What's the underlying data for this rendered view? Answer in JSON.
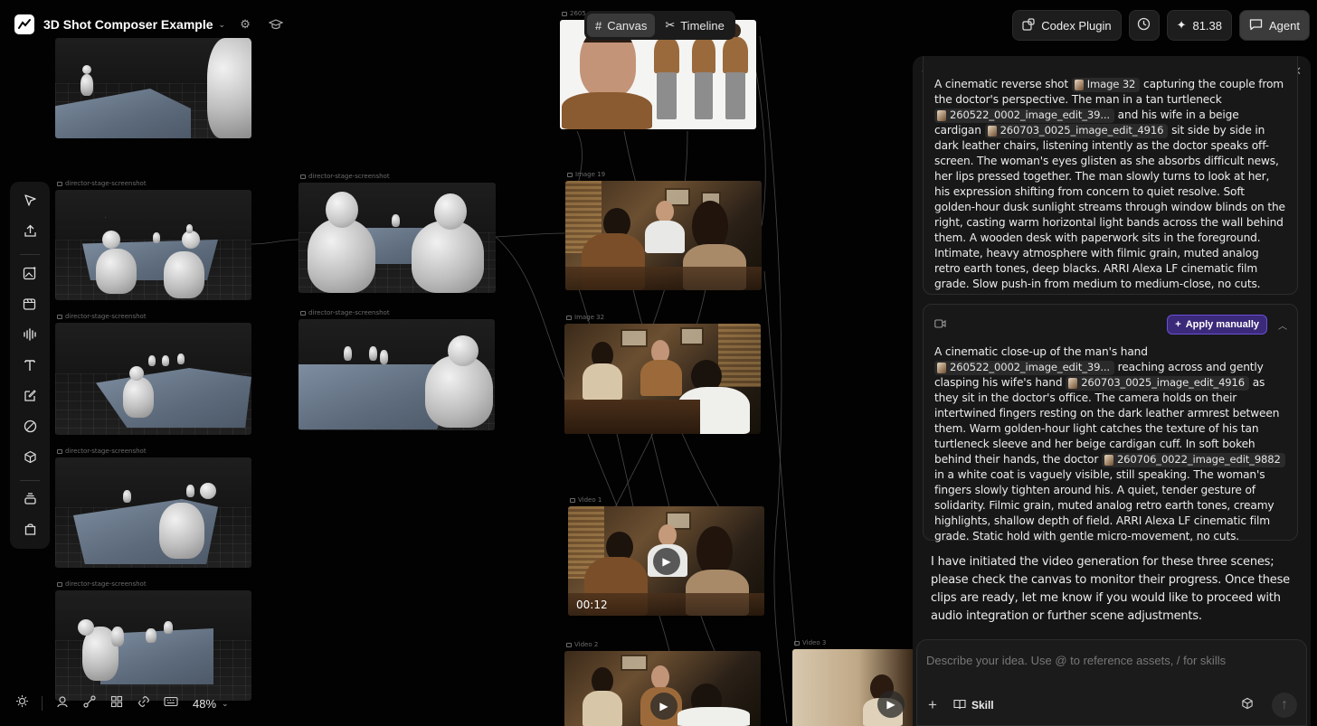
{
  "project": {
    "title": "3D Shot Composer Example"
  },
  "modes": [
    {
      "label": "Canvas",
      "active": true
    },
    {
      "label": "Timeline",
      "active": false
    }
  ],
  "top_right": {
    "plugin_label": "Codex Plugin",
    "credits": "81.38",
    "agent_label": "Agent"
  },
  "canvas": {
    "nodes": {
      "stage_label": "director-stage-screenshot",
      "img_top_label": "2605...",
      "image19_label": "Image 19",
      "image32_label": "Image 32",
      "video1_label": "Video 1",
      "video2_label": "Video 2",
      "video3_label": "Video 3",
      "video1_duration": "00:12"
    },
    "zoom": "48%"
  },
  "left_toolbar": [
    "select-icon",
    "upload-icon",
    "image-gen-icon",
    "video-gen-icon",
    "audio-icon",
    "text-icon",
    "note-icon",
    "draw-icon",
    "3d-icon",
    "stack-icon",
    "bag-icon"
  ],
  "bottom_toolbar": [
    "bug-icon",
    "person-icon",
    "connect-icon",
    "grid-icon",
    "link-icon",
    "keyboard-icon"
  ],
  "agent": {
    "count": "0",
    "card1": {
      "pre": "A cinematic reverse shot",
      "chip1": "Image 32",
      "t1": "capturing the couple from the doctor's perspective. The man in a tan turtleneck",
      "chip2": "260522_0002_image_edit_39...",
      "t2": "and his wife in a beige cardigan",
      "chip3": "260703_0025_image_edit_4916",
      "t3": "sit side by side in dark leather chairs, listening intently as the doctor speaks off-screen. The woman's eyes glisten as she absorbs difficult news, her lips pressed together. The man slowly turns to look at her, his expression shifting from concern to quiet resolve. Soft golden-hour dusk sunlight streams through window blinds on the right, casting warm horizontal light bands across the wall behind them. A wooden desk with paperwork sits in the foreground. Intimate, heavy atmosphere with filmic grain, muted analog retro earth tones, deep blacks. ARRI Alexa LF cinematic film grade. Slow push-in from medium to medium-close, no cuts."
    },
    "card2": {
      "apply_label": "Apply manually",
      "t0": "A cinematic close-up of the man's hand",
      "chip1": "260522_0002_image_edit_39...",
      "t1": "reaching across and gently clasping his wife's hand",
      "chip2": "260703_0025_image_edit_4916",
      "t2": "as they sit in the doctor's office. The camera holds on their intertwined fingers resting on the dark leather armrest between them. Warm golden-hour light catches the texture of his tan turtleneck sleeve and her beige cardigan cuff. In soft bokeh behind their hands, the doctor",
      "chip3": "260706_0022_image_edit_9882",
      "t3": "in a white coat is vaguely visible, still speaking. The woman's fingers slowly tighten around his. A quiet, tender gesture of solidarity. Filmic grain, muted analog retro earth tones, creamy highlights, shallow depth of field. ARRI Alexa LF cinematic film grade. Static hold with gentle micro-movement, no cuts."
    },
    "final_message": "I have initiated the video generation for these three scenes; please check the canvas to monitor their progress. Once these clips are ready, let me know if you would like to proceed with audio integration or further scene adjustments.",
    "input_placeholder": "Describe your idea. Use @ to reference assets, / for skills",
    "skill_label": "Skill"
  },
  "colors": {
    "accent_purple": "#6a4fd8",
    "panel_bg": "#151515",
    "canvas_bg": "#020202"
  }
}
